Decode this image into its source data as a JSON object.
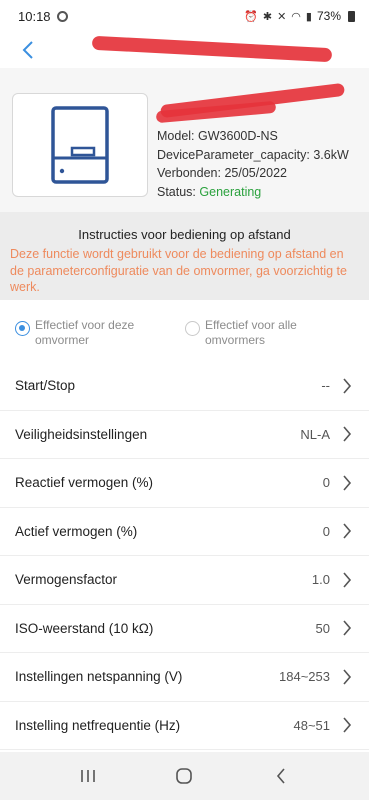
{
  "statusbar": {
    "time": "10:18",
    "battery": "73%"
  },
  "device": {
    "model_label": "Model:",
    "model": "GW3600D-NS",
    "capacity_label": "DeviceParameter_capacity:",
    "capacity": "3.6kW",
    "connected_label": "Verbonden:",
    "connected": "25/05/2022",
    "status_label": "Status:",
    "status": "Generating",
    "status_color": "#2aa13d"
  },
  "notice": {
    "title": "Instructies voor bediening op afstand",
    "text": "Deze functie wordt gebruikt voor de bediening op afstand en de parameterconfiguratie van de omvormer, ga voorzichtig te werk.",
    "color": "#ee8a5d"
  },
  "scope": {
    "options": [
      {
        "label": "Effectief voor deze omvormer",
        "selected": true
      },
      {
        "label": "Effectief voor alle omvormers",
        "selected": false
      }
    ],
    "accent": "#3b8fe0"
  },
  "settings": [
    {
      "name": "Start/Stop",
      "value": "--"
    },
    {
      "name": "Veiligheidsinstellingen",
      "value": "NL-A"
    },
    {
      "name": "Reactief vermogen (%)",
      "value": "0"
    },
    {
      "name": "Actief vermogen (%)",
      "value": "0"
    },
    {
      "name": "Vermogensfactor",
      "value": "1.0"
    },
    {
      "name": "ISO-weerstand (10 kΩ)",
      "value": "50"
    },
    {
      "name": "Instellingen netspanning (V)",
      "value": "184~253"
    },
    {
      "name": "Instelling netfrequentie (Hz)",
      "value": "48~51"
    }
  ]
}
